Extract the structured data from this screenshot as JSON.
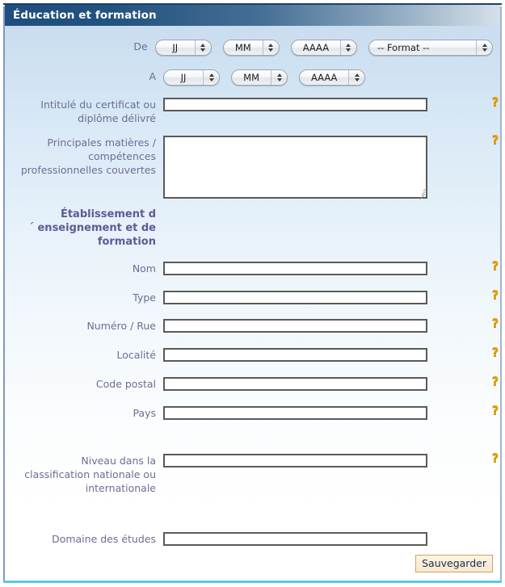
{
  "panel": {
    "title": "Éducation et formation"
  },
  "date_rows": [
    {
      "label": "De",
      "day": "JJ",
      "month": "MM",
      "year": "AAAA",
      "format": "-- Format --",
      "has_format": true
    },
    {
      "label": "A",
      "day": "JJ",
      "month": "MM",
      "year": "AAAA",
      "format": "",
      "has_format": false
    }
  ],
  "section_heading": "Établissement d\n´ enseignement et de\nformation",
  "fields": {
    "certificate_title": {
      "label": "Intitulé du certificat ou\ndiplôme délivré",
      "value": "",
      "help": "?"
    },
    "main_subjects": {
      "label": "Principales matières /\ncompétences\nprofessionnelles couvertes",
      "value": "",
      "help": "?"
    },
    "nom": {
      "label": "Nom",
      "value": "",
      "help": "?"
    },
    "type": {
      "label": "Type",
      "value": "",
      "help": "?"
    },
    "numero_rue": {
      "label": "Numéro / Rue",
      "value": "",
      "help": "?"
    },
    "localite": {
      "label": "Localité",
      "value": "",
      "help": "?"
    },
    "code_postal": {
      "label": "Code postal",
      "value": "",
      "help": "?"
    },
    "pays": {
      "label": "Pays",
      "value": "",
      "help": "?"
    },
    "niveau": {
      "label": "Niveau dans la\nclassification nationale ou\ninternationale",
      "value": "",
      "help": "?"
    },
    "domaine": {
      "label": "Domaine des études",
      "value": "",
      "help": ""
    }
  },
  "footer": {
    "save_label": "Sauvegarder"
  },
  "colors": {
    "title_bar_start": "#1f4e7f",
    "title_bar_end": "#d6e0e9",
    "label_text": "#6d6d95",
    "heading_text": "#5c5c93",
    "help_icon": "#e8a200",
    "save_button_bg": "#fdf3e0",
    "save_button_border": "#c7a76a",
    "save_button_text": "#1c2b52",
    "bottom_rule": "#5bc8e8",
    "frame_border": "#7f9bba",
    "input_border": "#5a5a5a"
  }
}
